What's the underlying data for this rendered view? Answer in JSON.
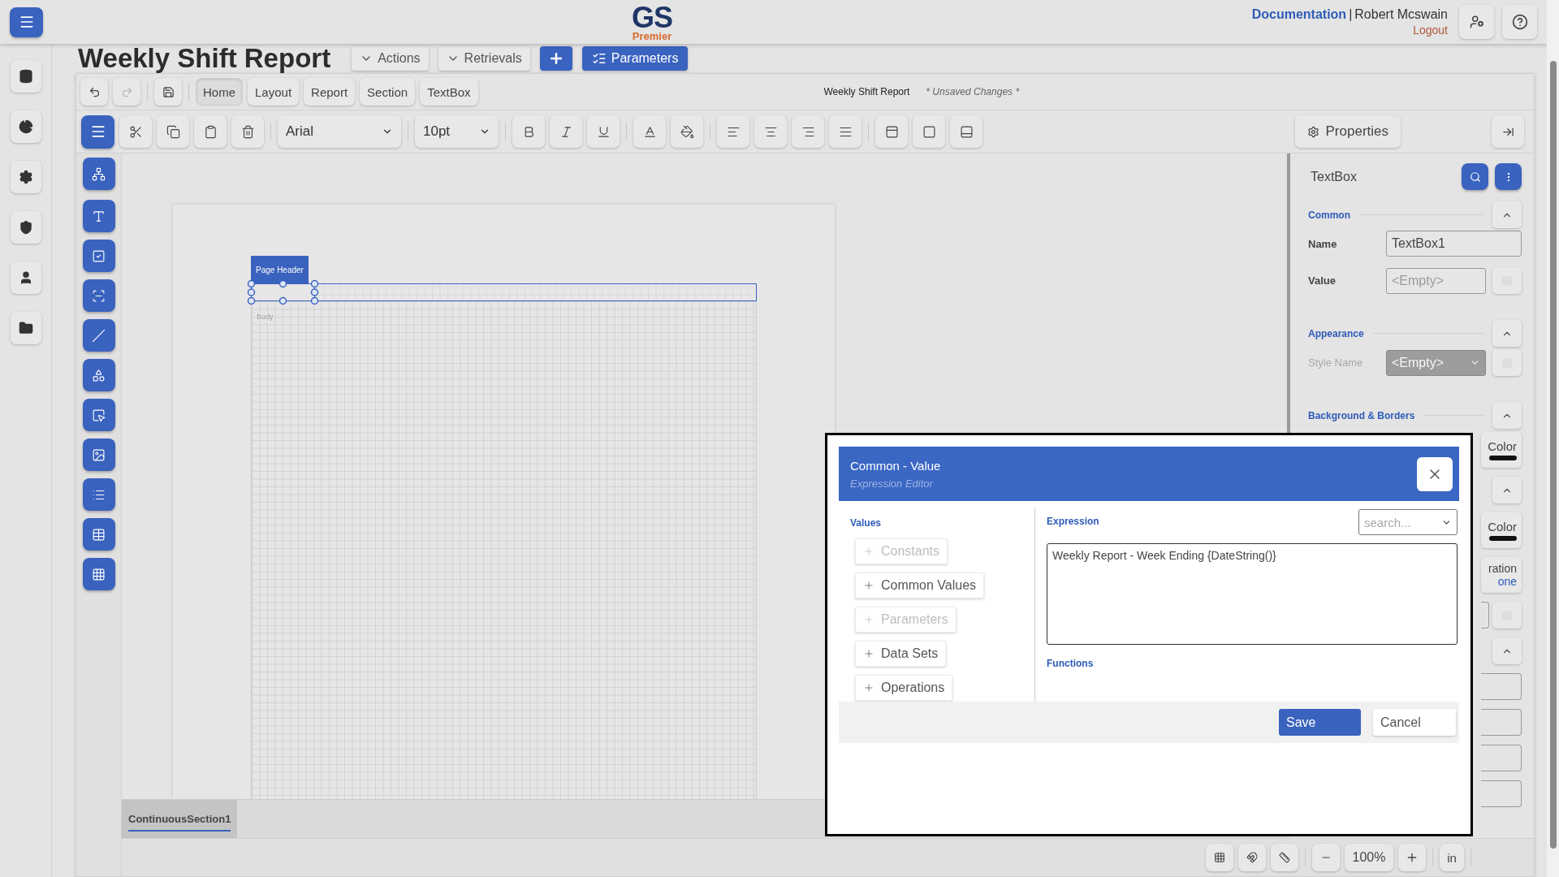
{
  "header": {
    "logo_main": "GS",
    "logo_sub": "Premier",
    "documentation_link": "Documentation",
    "separator": "|",
    "user": "Robert Mcswain",
    "logout": "Logout"
  },
  "page": {
    "title": "Weekly Shift Report",
    "buttons": [
      {
        "kind": "menu",
        "label": "Actions"
      },
      {
        "kind": "menu",
        "label": "Retrievals"
      },
      {
        "kind": "add"
      },
      {
        "kind": "primary",
        "label": "Parameters"
      }
    ]
  },
  "designer": {
    "history": [
      {
        "kind": "undo",
        "disabled": false
      },
      {
        "kind": "redo",
        "disabled": true
      }
    ],
    "tabs": [
      {
        "label": "Home",
        "selected": true
      },
      {
        "label": "Layout",
        "selected": false
      },
      {
        "label": "Report",
        "selected": false
      },
      {
        "label": "Section",
        "selected": false
      },
      {
        "label": "TextBox",
        "selected": false
      }
    ],
    "document_title": "Weekly Shift Report",
    "status": "* Unsaved Changes *",
    "font": "Arial",
    "font_size": "10pt",
    "properties_button": "Properties"
  },
  "canvas": {
    "section_label": "Page Header",
    "body_label": "Body",
    "sections": [
      {
        "label": "ContinuousSection1",
        "selected": true
      }
    ],
    "zoom": "100%",
    "unit": "in"
  },
  "properties": {
    "title": "TextBox",
    "groups": [
      {
        "title": "Common",
        "fields": [
          {
            "kind": "text",
            "label": "Name",
            "value": "TextBox1",
            "disabled": false
          },
          {
            "kind": "expression",
            "label": "Value",
            "placeholder": "<Empty>",
            "disabled": false
          }
        ]
      },
      {
        "title": "Appearance",
        "fields": [
          {
            "kind": "select",
            "label": "Style Name",
            "placeholder": "<Empty>",
            "disabled": true
          }
        ]
      },
      {
        "title": "Background & Borders"
      }
    ],
    "partial_rows": [
      {
        "kind": "color",
        "label": "Color"
      },
      {
        "kind": "collapse"
      },
      {
        "kind": "color",
        "label": "Color"
      },
      {
        "kind": "link",
        "label": "ration",
        "value": "one"
      },
      {
        "kind": "input"
      },
      {
        "kind": "collapse"
      },
      {
        "kind": "box"
      },
      {
        "kind": "box"
      },
      {
        "kind": "box"
      },
      {
        "kind": "box"
      }
    ]
  },
  "dialog": {
    "title": "Common - Value",
    "subtitle": "Expression Editor",
    "values_heading": "Values",
    "value_groups": [
      {
        "label": "Constants",
        "disabled": true
      },
      {
        "label": "Common Values",
        "disabled": false
      },
      {
        "label": "Parameters",
        "disabled": true
      },
      {
        "label": "Data Sets",
        "disabled": false
      },
      {
        "label": "Operations",
        "disabled": false
      }
    ],
    "expression_heading": "Expression",
    "search_placeholder": "search...",
    "expression": "Weekly Report - Week Ending {DateString()}",
    "functions_heading": "Functions",
    "save": "Save",
    "cancel": "Cancel"
  }
}
